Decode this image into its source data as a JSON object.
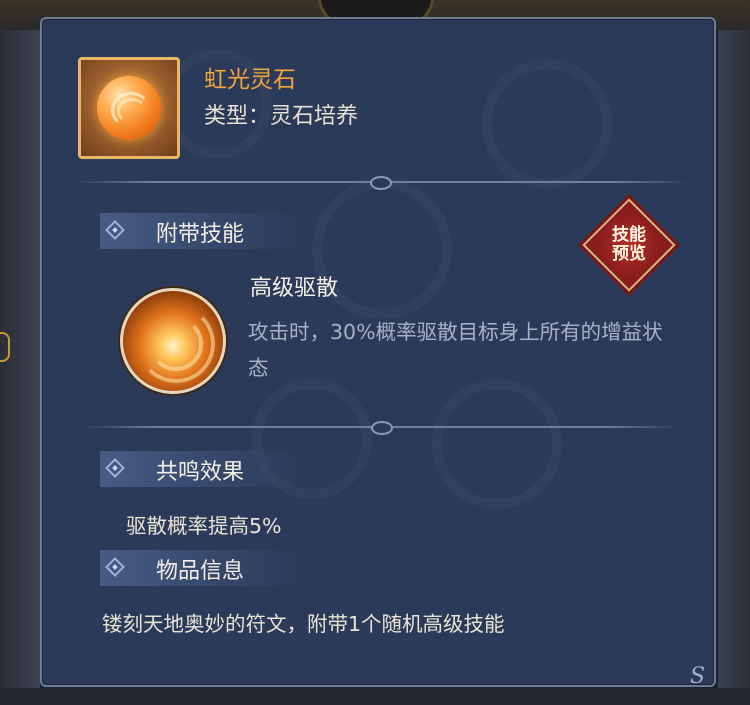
{
  "item": {
    "name": "虹光灵石",
    "type_line": "类型：灵石培养",
    "icon": "orange-spirit-stone-icon"
  },
  "skill_section": {
    "title": "附带技能",
    "preview_badge": [
      "技能",
      "预览"
    ],
    "skill_name": "高级驱散",
    "skill_desc": "攻击时，30%概率驱散目标身上所有的增益状态",
    "skill_icon": "golden-swirl-icon"
  },
  "resonance_section": {
    "title": "共鸣效果",
    "text": "驱散概率提高5%"
  },
  "info_section": {
    "title": "物品信息",
    "text": "镂刻天地奥妙的符文，附带1个随机高级技能"
  },
  "corner_mark": "S",
  "colors": {
    "panel_bg": "#2b3a59",
    "item_name": "#f2a53a",
    "body_text": "#e9e3d6",
    "desc_text": "#a9b2c4",
    "badge_red": "#b5302a"
  }
}
